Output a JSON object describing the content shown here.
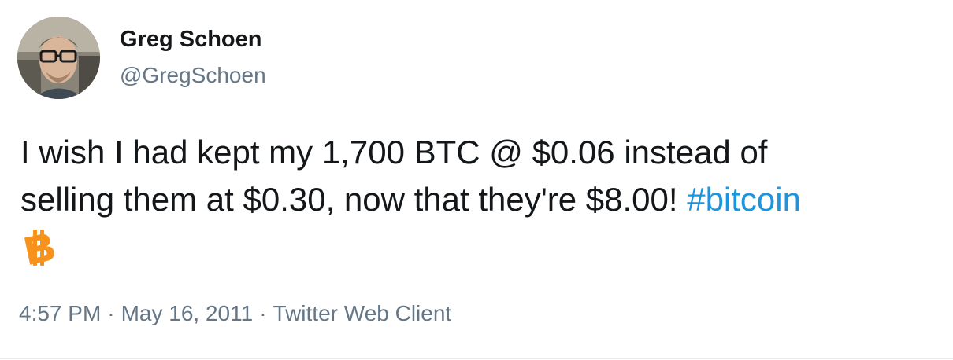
{
  "author": {
    "name": "Greg Schoen",
    "handle": "@GregSchoen"
  },
  "tweet": {
    "line1": "I wish I had kept my 1,700 BTC @ $0.06 instead of",
    "line2_prefix": "selling them at $0.30, now that they're $8.00! ",
    "hashtag": "#bitcoin",
    "emoji_icon": "bitcoin-icon"
  },
  "meta": {
    "time": "4:57 PM",
    "separator": "·",
    "date": "May 16, 2011",
    "client": "Twitter Web Client"
  },
  "colors": {
    "text": "#14171a",
    "secondary": "#657786",
    "link": "#1b95e0",
    "bitcoin": "#f7931a"
  }
}
